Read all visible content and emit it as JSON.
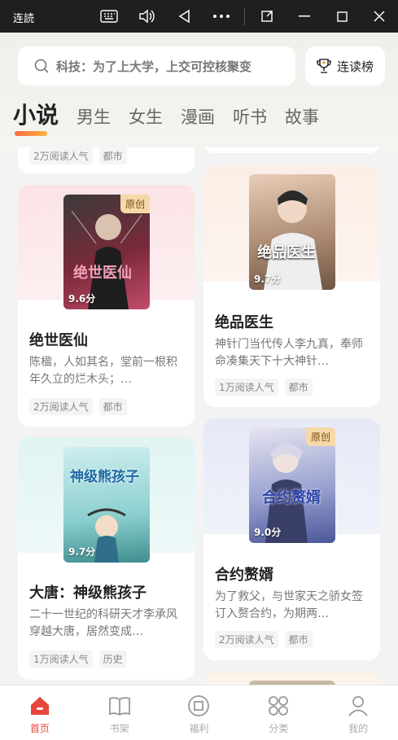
{
  "window": {
    "title": "连読"
  },
  "search": {
    "placeholder_text": "科技：为了上大学，上交可控核聚变"
  },
  "rank_button": {
    "label": "连读榜"
  },
  "tabs": [
    {
      "label": "小说",
      "active": true
    },
    {
      "label": "男生",
      "active": false
    },
    {
      "label": "女生",
      "active": false
    },
    {
      "label": "漫画",
      "active": false
    },
    {
      "label": "听书",
      "active": false
    },
    {
      "label": "故事",
      "active": false
    }
  ],
  "partial_top_left": {
    "readers": "2万阅读人气",
    "genre": "都市"
  },
  "books": [
    {
      "title": "绝世医仙",
      "desc": "陈楹，人如其名，堂前一根积年久立的烂木头；…",
      "readers": "2万阅读人气",
      "genre": "都市",
      "score": "9.6分",
      "tag": "原创",
      "cover_caption": "绝世医仙"
    },
    {
      "title": "绝品医生",
      "desc": "神针门当代传人李九真，奉师命凑集天下十大神针…",
      "readers": "1万阅读人气",
      "genre": "都市",
      "score": "9.7分",
      "tag": "",
      "cover_caption": "绝品医生"
    },
    {
      "title": "大唐：神级熊孩子",
      "desc": "二十一世纪的科研天才李承风穿越大唐，居然变成…",
      "readers": "1万阅读人气",
      "genre": "历史",
      "score": "9.7分",
      "tag": "",
      "cover_caption": "神级熊孩子"
    },
    {
      "title": "合约赘婿",
      "desc": "为了救父，与世家天之骄女签订入赘合约，为期两…",
      "readers": "2万阅读人气",
      "genre": "都市",
      "score": "9.0分",
      "tag": "原创",
      "cover_caption": "合约赘婿"
    }
  ],
  "bottom_nav": [
    {
      "label": "首页",
      "icon": "home-icon",
      "active": true
    },
    {
      "label": "书架",
      "icon": "bookshelf-icon",
      "active": false
    },
    {
      "label": "福利",
      "icon": "welfare-icon",
      "active": false
    },
    {
      "label": "分类",
      "icon": "category-icon",
      "active": false
    },
    {
      "label": "我的",
      "icon": "profile-icon",
      "active": false
    }
  ],
  "colors": {
    "accent": "#e8453c",
    "tag_bg": "#f5d9a8",
    "titlebar": "#1f1f1f"
  }
}
